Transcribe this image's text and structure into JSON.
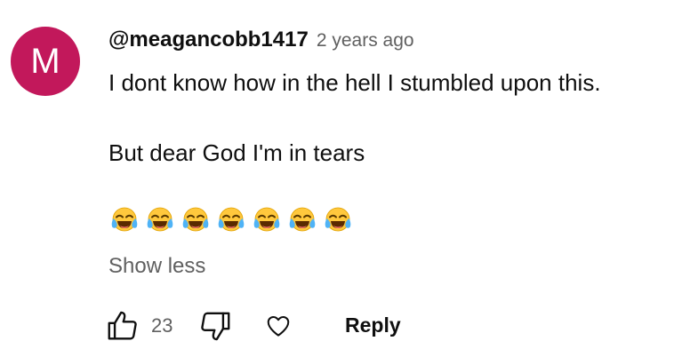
{
  "comment": {
    "avatar_letter": "M",
    "avatar_color": "#c2185b",
    "author": "@meagancobb1417",
    "time": "2 years ago",
    "lines": [
      "I dont know how in the hell I stumbled upon this.",
      "But dear God I'm in tears"
    ],
    "emojis": [
      "😂",
      "😂",
      "😂",
      "😂",
      "😂",
      "😂",
      "😂"
    ],
    "show_less_label": "Show less"
  },
  "actions": {
    "like_count": "23",
    "like_icon": "thumbs-up-icon",
    "dislike_icon": "thumbs-down-icon",
    "heart_icon": "heart-icon",
    "reply_label": "Reply"
  },
  "colors": {
    "text_primary": "#0f0f0f",
    "text_secondary": "#606060"
  }
}
